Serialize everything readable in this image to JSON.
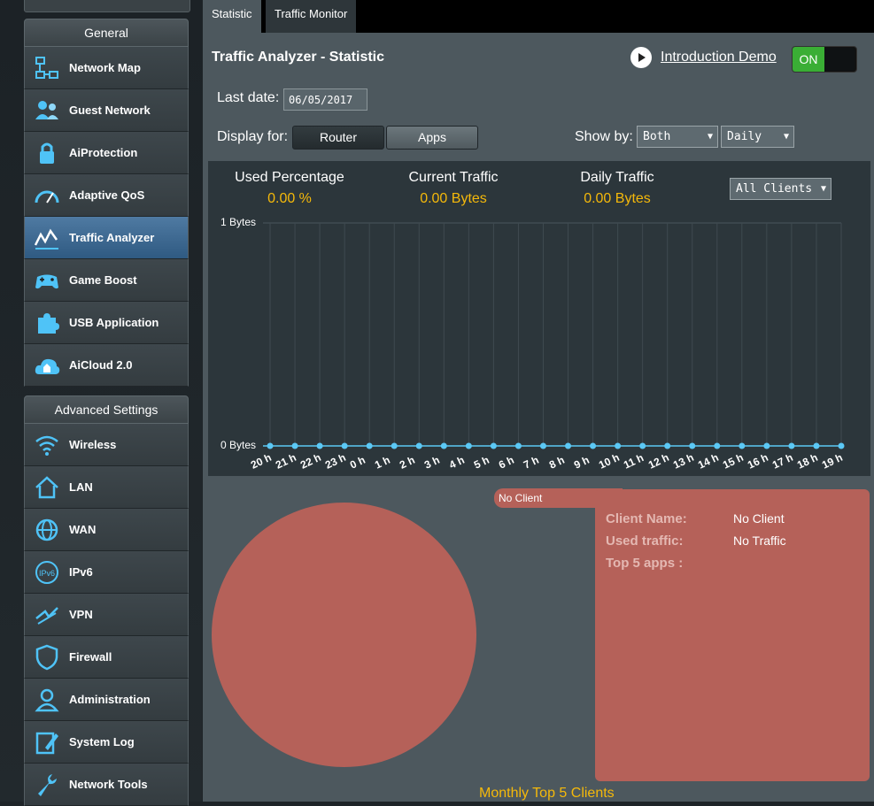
{
  "sidebar": {
    "general_header": "General",
    "general_items": [
      {
        "label": "Network Map",
        "icon": "network-map-icon"
      },
      {
        "label": "Guest Network",
        "icon": "guest-network-icon"
      },
      {
        "label": "AiProtection",
        "icon": "lock-icon"
      },
      {
        "label": "Adaptive QoS",
        "icon": "speedometer-icon"
      },
      {
        "label": "Traffic Analyzer",
        "icon": "traffic-chart-icon",
        "active": true
      },
      {
        "label": "Game Boost",
        "icon": "gamepad-icon"
      },
      {
        "label": "USB Application",
        "icon": "puzzle-icon"
      },
      {
        "label": "AiCloud 2.0",
        "icon": "cloud-home-icon"
      }
    ],
    "advanced_header": "Advanced Settings",
    "advanced_items": [
      {
        "label": "Wireless",
        "icon": "wifi-icon"
      },
      {
        "label": "LAN",
        "icon": "home-icon"
      },
      {
        "label": "WAN",
        "icon": "globe-icon"
      },
      {
        "label": "IPv6",
        "icon": "ipv6-icon"
      },
      {
        "label": "VPN",
        "icon": "vpn-icon"
      },
      {
        "label": "Firewall",
        "icon": "shield-icon"
      },
      {
        "label": "Administration",
        "icon": "admin-user-icon"
      },
      {
        "label": "System Log",
        "icon": "system-log-icon"
      },
      {
        "label": "Network Tools",
        "icon": "wrench-icon"
      }
    ]
  },
  "tabs": {
    "statistic": "Statistic",
    "traffic_monitor": "Traffic Monitor"
  },
  "header": {
    "title": "Traffic Analyzer - Statistic",
    "demo_link": "Introduction Demo",
    "toggle_label": "ON"
  },
  "controls": {
    "last_date_label": "Last date:",
    "last_date_value": "06/05/2017",
    "display_for_label": "Display for:",
    "router_button": "Router",
    "apps_button": "Apps",
    "show_by_label": "Show by:",
    "show_by_value": "Both",
    "period_value": "Daily",
    "clients_value": "All Clients"
  },
  "stats": {
    "used_percentage_label": "Used Percentage",
    "used_percentage_value": "0.00 %",
    "current_traffic_label": "Current Traffic",
    "current_traffic_value": "0.00 Bytes",
    "daily_traffic_label": "Daily Traffic",
    "daily_traffic_value": "0.00 Bytes"
  },
  "colors": {
    "accent_yellow": "#f5b90a",
    "point_blue": "#5bc8f5",
    "client_red": "#b56159",
    "active_blue": "#3e6a92"
  },
  "chart_data": {
    "type": "line",
    "y_tick_labels": [
      "1 Bytes",
      "0 Bytes"
    ],
    "ylim": [
      0,
      1
    ],
    "categories": [
      "20 h",
      "21 h",
      "22 h",
      "23 h",
      "0 h",
      "1 h",
      "2 h",
      "3 h",
      "4 h",
      "5 h",
      "6 h",
      "7 h",
      "8 h",
      "9 h",
      "10 h",
      "11 h",
      "12 h",
      "13 h",
      "14 h",
      "15 h",
      "16 h",
      "17 h",
      "18 h",
      "19 h"
    ],
    "values": [
      0,
      0,
      0,
      0,
      0,
      0,
      0,
      0,
      0,
      0,
      0,
      0,
      0,
      0,
      0,
      0,
      0,
      0,
      0,
      0,
      0,
      0,
      0,
      0
    ],
    "grid": true
  },
  "clients": {
    "tab_label": "No Client",
    "client_name_label": "Client Name:",
    "client_name_value": "No Client",
    "used_traffic_label": "Used traffic:",
    "used_traffic_value": "No Traffic",
    "top_apps_label": "Top 5 apps :",
    "pie_values": [
      1
    ],
    "monthly_title": "Monthly Top 5 Clients"
  }
}
